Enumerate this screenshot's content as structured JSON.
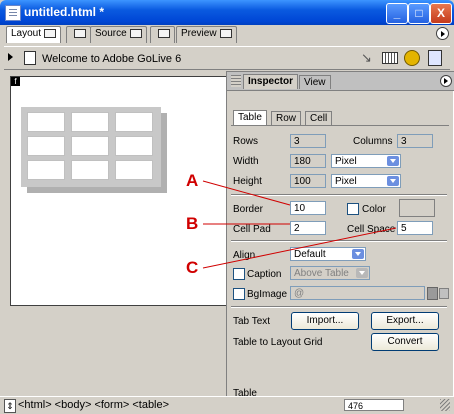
{
  "window": {
    "title": "untitled.html *"
  },
  "title_buttons": {
    "minimize": "_",
    "maximize": "□",
    "close": "X"
  },
  "tabs": [
    {
      "label": "Layout"
    },
    {
      "label": ""
    },
    {
      "label": "Source"
    },
    {
      "label": ""
    },
    {
      "label": "Preview"
    }
  ],
  "toolbar": {
    "page_title": "Welcome to Adobe GoLive 6"
  },
  "document": {
    "frame_marker": "f"
  },
  "inspector": {
    "tabs": [
      {
        "label": "Inspector"
      },
      {
        "label": "View"
      }
    ],
    "subtabs": [
      {
        "label": "Table"
      },
      {
        "label": "Row"
      },
      {
        "label": "Cell"
      }
    ],
    "rows_label": "Rows",
    "rows_value": "3",
    "columns_label": "Columns",
    "columns_value": "3",
    "width_label": "Width",
    "width_value": "180",
    "width_unit": "Pixel",
    "height_label": "Height",
    "height_value": "100",
    "height_unit": "Pixel",
    "border_label": "Border",
    "border_value": "10",
    "color_label": "Color",
    "cellpad_label": "Cell Pad",
    "cellpad_value": "2",
    "cellspace_label": "Cell Space",
    "cellspace_value": "5",
    "align_label": "Align",
    "align_value": "Default",
    "caption_label": "Caption",
    "caption_value": "Above Table",
    "bgimage_label": "BgImage",
    "bgimage_value": "@",
    "tabtext_label": "Tab Text",
    "import_button": "Import...",
    "export_button": "Export...",
    "layoutgrid_label": "Table to Layout Grid",
    "convert_button": "Convert",
    "footer_label": "Table"
  },
  "annotations": [
    {
      "letter": "A"
    },
    {
      "letter": "B"
    },
    {
      "letter": "C"
    }
  ],
  "status": {
    "breadcrumb": "<html> <body> <form> <table>",
    "size": "476"
  },
  "colors": {
    "titlebar": "#0a5ae0",
    "annotation": "#d00000"
  }
}
